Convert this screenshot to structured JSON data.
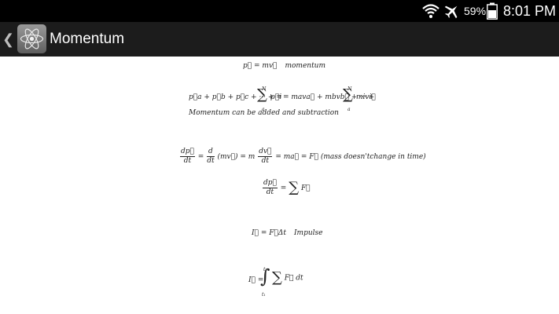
{
  "status_bar": {
    "battery_percent": "59%",
    "time": "8:01 PM",
    "icons": [
      "wifi-icon",
      "airplane-mode-icon",
      "battery-icon"
    ]
  },
  "action_bar": {
    "title": "Momentum",
    "back_icon": "chevron-left-icon",
    "app_icon": "atom-icon"
  },
  "equations": {
    "eq1": {
      "expr": "p⃗ = mv⃗",
      "label": "momentum"
    },
    "eq2": {
      "left": "p⃗a + p⃗b + p⃗c + ··· + =",
      "sum1_top": "N",
      "sum1_bottom": "a",
      "sum1_term": "p⃗i",
      "middle": "= mava⃗ + mbvb⃗ + ··· +",
      "sum2_top": "N",
      "sum2_bottom": "a",
      "sum2_term": "mivi⃗",
      "note": "Momentum can be added and subtraction"
    },
    "eq3": {
      "frac1_num": "dp⃗",
      "frac1_den": "dt",
      "frac2_num": "d",
      "frac2_den": "dt",
      "mid": "(mv⃗) = m",
      "frac3_num": "dv⃗",
      "frac3_den": "dt",
      "tail": "= ma⃗ = F⃗",
      "note": "(mass doesn'tchange in time)"
    },
    "eq4": {
      "frac_num": "dp⃗",
      "frac_den": "dt",
      "sum": "∑",
      "term": "F⃗"
    },
    "eq5": {
      "expr": "I⃗ = F⃗Δt",
      "label": "Impulse"
    },
    "eq6": {
      "lhs": "I⃗ =",
      "integral": "∫",
      "upper": "t₂",
      "lower": "t₁",
      "sum": "∑",
      "term": "F⃗ dt"
    }
  }
}
